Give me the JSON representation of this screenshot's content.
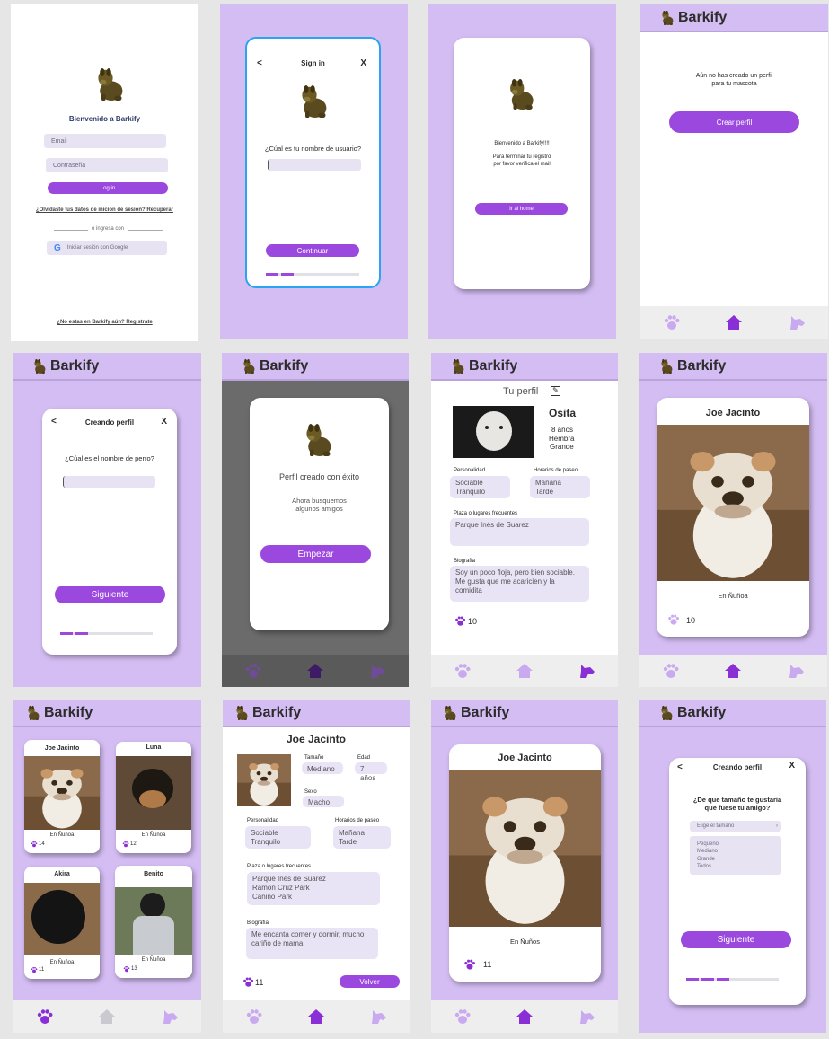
{
  "brand": "Barkify",
  "colors": {
    "accent": "#9a48dd",
    "lavender": "#d4bdf3",
    "field": "#e8e3f3"
  },
  "login": {
    "title": "Bienvenido a Barkify",
    "email_placeholder": "Email",
    "password_placeholder": "Contraseña",
    "login_button": "Log in",
    "forgot": "¿Olvidaste tus datos de inicion de sesión? Recuperar",
    "or": "o ingresa  con",
    "google": "Iniciar sesión con Google",
    "register": "¿No estas en Barkify aún? Registrate"
  },
  "signin": {
    "back": "<",
    "title": "Sign in",
    "close": "X",
    "question": "¿Cúal es tu nombre de usuario?",
    "continue": "Continuar"
  },
  "verify": {
    "line1": "Bienvenido a Barkify!!!!",
    "line2": "Para terminar tu registro",
    "line3": "por favor verifica el mail",
    "button": "Ir al home"
  },
  "noprofile": {
    "line1": "Aún no has creado un perfil",
    "line2": "para tu mascota",
    "button": "Crear perfil"
  },
  "create_name": {
    "back": "<",
    "title": "Creando perfil",
    "close": "X",
    "question": "¿Cúal es el nombre de perro?",
    "button": "Siguiente"
  },
  "created": {
    "title": "Perfil creado con éxito",
    "line1": "Ahora busquemos",
    "line2": "algunos amigos",
    "button": "Empezar"
  },
  "my_profile": {
    "heading": "Tu perfil",
    "name": "Osita",
    "age": "8 años",
    "sex": "Hembra",
    "size": "Grande",
    "personality_label": "Personalidad",
    "personality_1": "Sociable",
    "personality_2": "Tranquilo",
    "walk_label": "Horarios de paseo",
    "walk_1": "Mañana",
    "walk_2": "Tarde",
    "places_label": "Plaza o lugares frecuentes",
    "places": "Parque Inés de Suarez",
    "bio_label": "Biografía",
    "bio_1": "Soy un poco floja, pero bien sociable.",
    "bio_2": "Me gusta que me acaricien y la",
    "bio_3": "comidita",
    "paws": "10"
  },
  "match_card": {
    "name": "Joe Jacinto",
    "location": "En Ñuñoa",
    "paws": "10"
  },
  "friends": [
    {
      "name": "Joe Jacinto",
      "location": "En Ñuñoa",
      "paws": "14"
    },
    {
      "name": "Luna",
      "location": "En Ñuñoa",
      "paws": "12"
    },
    {
      "name": "Akira",
      "location": "En Ñuñoa",
      "paws": "11"
    },
    {
      "name": "Benito",
      "location": "En Ñuñoa",
      "paws": "13"
    }
  ],
  "friend_profile": {
    "name": "Joe Jacinto",
    "size_label": "Tamaño",
    "size": "Mediano",
    "age_label": "Edad",
    "age": "7 años",
    "sex_label": "Sexo",
    "sex": "Macho",
    "personality_label": "Personalidad",
    "personality_1": "Sociable",
    "personality_2": "Tranquilo",
    "walk_label": "Horarios de paseo",
    "walk_1": "Mañana",
    "walk_2": "Tarde",
    "places_label": "Plaza o lugares frecuentes",
    "places_1": "Parque Inés de Suarez",
    "places_2": "Ramón Cruz Park",
    "places_3": "Canino Park",
    "bio_label": "Biografía",
    "bio_1": "Me encanta comer y dormir, mucho",
    "bio_2": "cariño de mama.",
    "paws": "11",
    "back_button": "Volver"
  },
  "match_card_2": {
    "name": "Joe Jacinto",
    "location": "En Ñuños",
    "paws": "11"
  },
  "size_pref": {
    "back": "<",
    "title": "Creando perfil",
    "close": "X",
    "question_1": "¿De que tamaño te gustaria",
    "question_2": "que fuese tu amigo?",
    "select_placeholder": "Elige el tamaño",
    "options": [
      "Pequeño",
      "Mediano",
      "Grande",
      "Todos"
    ],
    "button": "Siguiente"
  }
}
